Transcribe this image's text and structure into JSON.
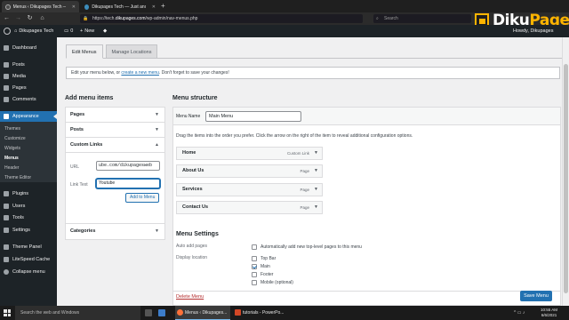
{
  "browser": {
    "tabs": [
      {
        "title": "Menus ‹ Dikupages Tech — WordP",
        "active": true
      },
      {
        "title": "Dikupages Tech — Just another Wo",
        "active": false
      }
    ],
    "new_tab": "+",
    "url_prefix": "https://tech.",
    "url_host": "dikupages.com",
    "url_path": "/wp-admin/nav-menus.php",
    "search_placeholder": "Search"
  },
  "watermark": {
    "word_main": "Diku",
    "word_accent": "Pages"
  },
  "admin_bar": {
    "site_name": "Dikupages Tech",
    "comments_count": "0",
    "new_label": "New",
    "howdy": "Howdy, Dikupages"
  },
  "sidebar": {
    "items": [
      {
        "label": "Dashboard"
      },
      {
        "label": "Posts"
      },
      {
        "label": "Media"
      },
      {
        "label": "Pages"
      },
      {
        "label": "Comments"
      },
      {
        "label": "Appearance"
      },
      {
        "label": "Plugins"
      },
      {
        "label": "Users"
      },
      {
        "label": "Tools"
      },
      {
        "label": "Settings"
      },
      {
        "label": "Theme Panel"
      },
      {
        "label": "LiteSpeed Cache"
      },
      {
        "label": "Collapse menu"
      }
    ],
    "submenu": [
      {
        "label": "Themes"
      },
      {
        "label": "Customize"
      },
      {
        "label": "Widgets"
      },
      {
        "label": "Menus"
      },
      {
        "label": "Header"
      },
      {
        "label": "Theme Editor"
      }
    ]
  },
  "tabs": {
    "edit": "Edit Menus",
    "manage": "Manage Locations"
  },
  "notice": {
    "before": "Edit your menu below, or ",
    "link": "create a new menu",
    "after": ". Don't forget to save your changes!"
  },
  "add_items": {
    "title": "Add menu items",
    "sections": [
      {
        "label": "Pages"
      },
      {
        "label": "Posts"
      },
      {
        "label": "Custom Links"
      },
      {
        "label": "Categories"
      }
    ],
    "url_label": "URL",
    "url_value": "ube.com/dikupagesweb",
    "link_text_label": "Link Text",
    "link_text_value": "Youtube",
    "add_button": "Add to Menu"
  },
  "structure": {
    "title": "Menu structure",
    "menu_name_label": "Menu Name",
    "menu_name_value": "Main Menu",
    "instructions": "Drag the items into the order you prefer. Click the arrow on the right of the item to reveal additional configuration options.",
    "items": [
      {
        "label": "Home",
        "type": "Custom Link"
      },
      {
        "label": "About Us",
        "type": "Page"
      },
      {
        "label": "Services",
        "type": "Page"
      },
      {
        "label": "Contact Us",
        "type": "Page"
      }
    ],
    "settings_title": "Menu Settings",
    "auto_add_label": "Auto add pages",
    "auto_add_option": "Automatically add new top-level pages to this menu",
    "display_location_label": "Display location",
    "locations": [
      {
        "label": "Top Bar",
        "checked": false
      },
      {
        "label": "Main",
        "checked": true
      },
      {
        "label": "Footer",
        "checked": false
      },
      {
        "label": "Mobile (optional)",
        "checked": false
      }
    ],
    "delete_label": "Delete Menu",
    "save_label": "Save Menu"
  },
  "taskbar": {
    "search_placeholder": "Search the web and Windows",
    "apps": [
      {
        "label": "Menus ‹ Dikupages..."
      },
      {
        "label": "tutorials - PowerPo..."
      }
    ],
    "time": "10:55 AM",
    "date": "6/6/2021"
  },
  "colors": {
    "admin_bar": "#1d2327",
    "accent": "#2271b1",
    "danger": "#b32d2e",
    "brand_accent": "#ffb400"
  }
}
